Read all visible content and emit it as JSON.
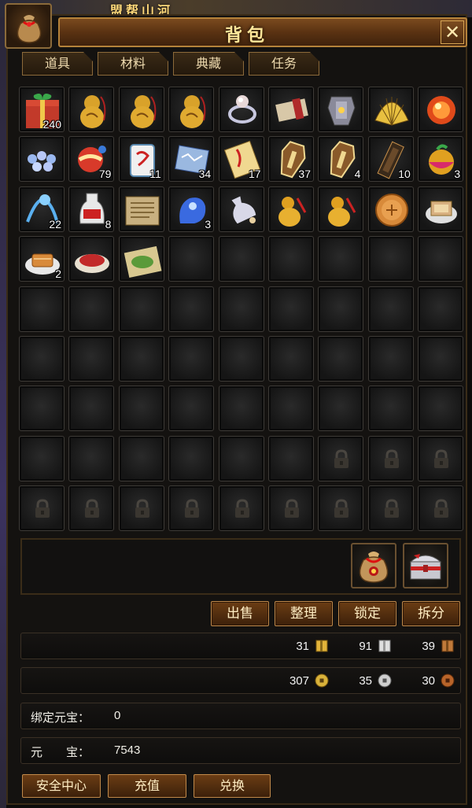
{
  "background": {
    "scene_title": "盟帮山河"
  },
  "window": {
    "title": "背包",
    "close_label": "✕"
  },
  "tabs": [
    {
      "label": "道具",
      "active": true
    },
    {
      "label": "材料",
      "active": false
    },
    {
      "label": "典藏",
      "active": false
    },
    {
      "label": "任务",
      "active": false
    }
  ],
  "grid": {
    "columns": 9,
    "rows": 9,
    "items": [
      {
        "icon": "gift-box-icon",
        "count": "240"
      },
      {
        "icon": "gourd-amulet-icon",
        "count": ""
      },
      {
        "icon": "gourd-amulet-icon",
        "count": ""
      },
      {
        "icon": "gourd-amulet-icon",
        "count": ""
      },
      {
        "icon": "pearl-ring-icon",
        "count": ""
      },
      {
        "icon": "scroll-icon",
        "count": ""
      },
      {
        "icon": "armor-icon",
        "count": ""
      },
      {
        "icon": "golden-fan-icon",
        "count": ""
      },
      {
        "icon": "fire-orb-icon",
        "count": ""
      },
      {
        "icon": "pearl-string-icon",
        "count": ""
      },
      {
        "icon": "red-orb-icon",
        "count": "79"
      },
      {
        "icon": "mahjong-tile-icon",
        "count": "11"
      },
      {
        "icon": "map-scroll-icon",
        "count": "34"
      },
      {
        "icon": "talisman-paper-icon",
        "count": "17"
      },
      {
        "icon": "coffin-token-icon",
        "count": "37"
      },
      {
        "icon": "coffin-token-icon",
        "count": "4"
      },
      {
        "icon": "dark-pillar-icon",
        "count": "10"
      },
      {
        "icon": "rainbow-fruit-icon",
        "count": "3"
      },
      {
        "icon": "blue-lamp-icon",
        "count": "22"
      },
      {
        "icon": "wine-bottle-icon",
        "count": "8"
      },
      {
        "icon": "old-document-icon",
        "count": ""
      },
      {
        "icon": "blue-spirit-icon",
        "count": "3"
      },
      {
        "icon": "silver-vase-icon",
        "count": ""
      },
      {
        "icon": "golden-gourd-icon",
        "count": ""
      },
      {
        "icon": "golden-gourd-icon",
        "count": ""
      },
      {
        "icon": "mooncake-icon",
        "count": ""
      },
      {
        "icon": "cake-box-icon",
        "count": ""
      },
      {
        "icon": "pastry-plate-icon",
        "count": "2"
      },
      {
        "icon": "red-powder-bowl-icon",
        "count": ""
      },
      {
        "icon": "green-powder-icon",
        "count": ""
      }
    ],
    "locked_from": 69
  },
  "special_slots": [
    {
      "icon": "money-bag-icon"
    },
    {
      "icon": "treasure-chest-icon"
    }
  ],
  "actions": [
    {
      "label": "出售"
    },
    {
      "label": "整理"
    },
    {
      "label": "锁定"
    },
    {
      "label": "拆分"
    }
  ],
  "currency_row_1": [
    {
      "value": "31",
      "icon": "gold-ingot-icon",
      "color": "#e2b43a"
    },
    {
      "value": "91",
      "icon": "silver-ingot-icon",
      "color": "#d8d8d8"
    },
    {
      "value": "39",
      "icon": "bronze-ingot-icon",
      "color": "#c07a3a"
    }
  ],
  "currency_row_2": [
    {
      "value": "307",
      "icon": "gold-coin-icon",
      "color": "#d9b23a"
    },
    {
      "value": "35",
      "icon": "silver-coin-icon",
      "color": "#cfcfcf"
    },
    {
      "value": "30",
      "icon": "copper-coin-icon",
      "color": "#b8642a"
    }
  ],
  "bound_yuanbao": {
    "label": "绑定元宝：",
    "value": "0"
  },
  "yuanbao": {
    "label": "元　　宝：",
    "value": "7543"
  },
  "footer_buttons": [
    {
      "label": "安全中心"
    },
    {
      "label": "充值"
    },
    {
      "label": "兑换"
    }
  ]
}
